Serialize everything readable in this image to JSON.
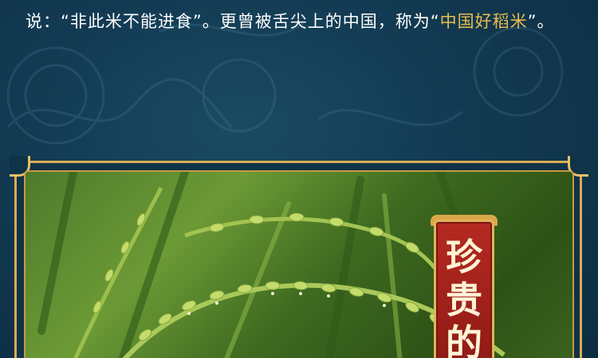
{
  "intro": {
    "text_before": "说：“非此米不能进食”。更曾被舌尖上的中国，称为“",
    "highlight": "中国好稻米",
    "text_after": "”。"
  },
  "banner": {
    "char1": "珍",
    "char2": "贵",
    "char3": "的"
  },
  "colors": {
    "background": "#123a52",
    "gold": "#e9bd4e",
    "banner_red": "#a52219"
  },
  "image": {
    "subject": "rice-plant-photo"
  }
}
